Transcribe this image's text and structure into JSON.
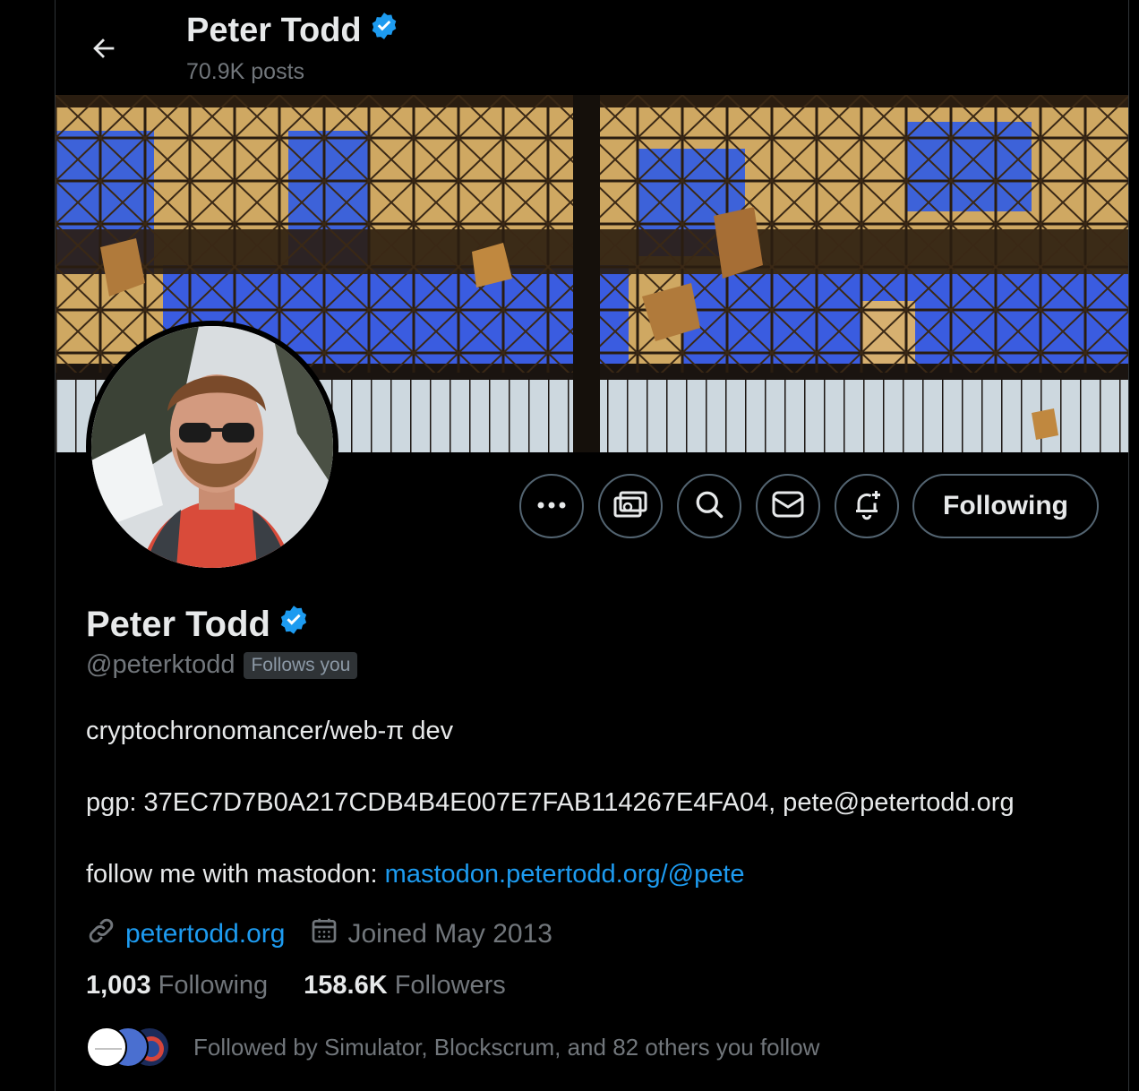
{
  "header": {
    "name": "Peter Todd",
    "posts": "70.9K posts"
  },
  "actions": {
    "follow_label": "Following"
  },
  "profile": {
    "name": "Peter Todd",
    "handle": "@peterktodd",
    "follows_you": "Follows you",
    "bio_line1": "cryptochronomancer/web-π dev",
    "bio_line2": "pgp: 37EC7D7B0A217CDB4B4E007E7FAB114267E4FA04, pete@petertodd.org",
    "bio_line3_prefix": "follow me with mastodon: ",
    "bio_line3_link": "mastodon.petertodd.org/@pete",
    "website": "petertodd.org",
    "joined": "Joined May 2013"
  },
  "stats": {
    "following_count": "1,003",
    "following_label": "Following",
    "followers_count": "158.6K",
    "followers_label": "Followers"
  },
  "followed_by": {
    "text": "Followed by Simulator, Blockscrum, and 82 others you follow"
  },
  "colors": {
    "accent": "#1d9bf0",
    "verified": "#1d9bf0",
    "muted": "#71767b",
    "border": "#536471"
  }
}
